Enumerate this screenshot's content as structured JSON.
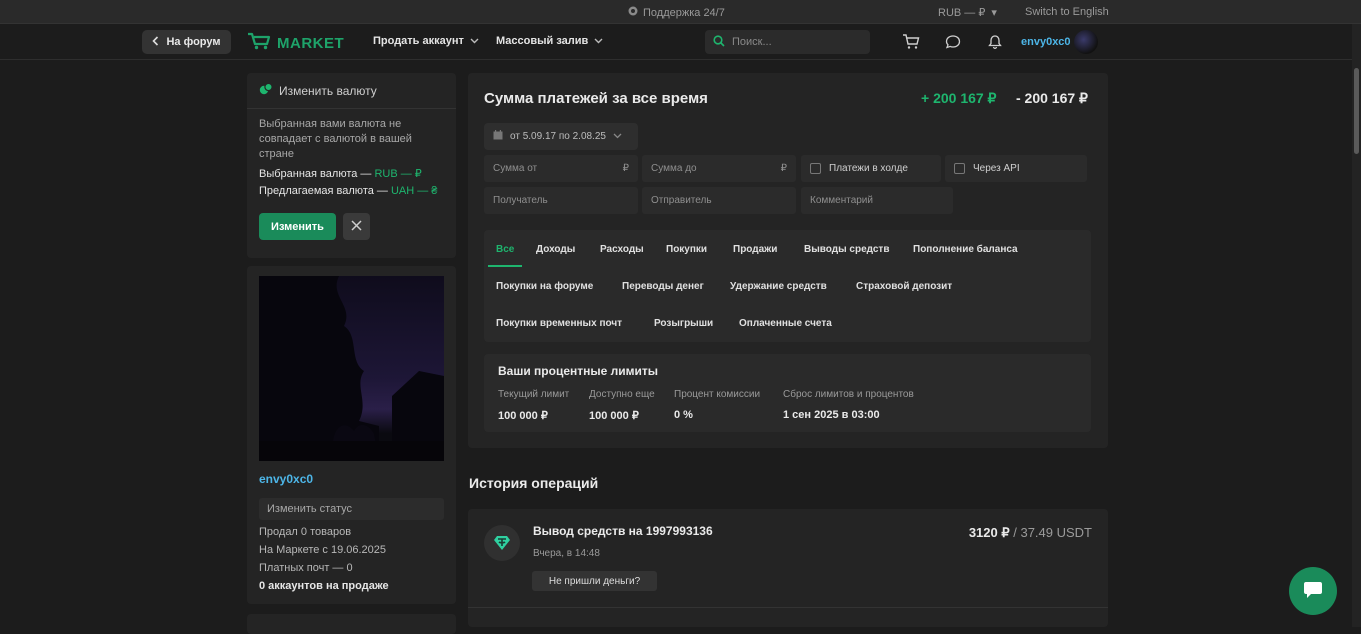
{
  "topbar": {
    "support": "Поддержка 24/7",
    "currency": "RUB — ₽",
    "currency_arrow": "▾",
    "language": "Switch to English"
  },
  "nav": {
    "back_label": "На форум",
    "logo_text": "MARKET",
    "menu": [
      {
        "label": "Продать аккаунт"
      },
      {
        "label": "Массовый залив"
      }
    ],
    "search_placeholder": "Поиск...",
    "username": "envy0xc0"
  },
  "currency_card": {
    "title": "Изменить валюту",
    "text": "Выбранная вами валюта не совпадает с валютой в вашей стране",
    "selected_label": "Выбранная валюта — ",
    "selected_value": "RUB — ₽",
    "suggested_label": "Предлагаемая валюта — ",
    "suggested_value": "UAH — ₴",
    "change_button": "Изменить"
  },
  "profile": {
    "name": "envy0xc0",
    "status_placeholder": "Изменить статус",
    "sold": "Продал 0 товаров",
    "since": "На Маркете с 19.06.2025",
    "paid_mail": "Платных почт — 0",
    "accounts": "0 аккаунтов на продаже"
  },
  "payments": {
    "title": "Сумма платежей за все время",
    "income": "+ 200 167 ₽",
    "outcome": "- 200 167 ₽",
    "date_range": "от 5.09.17 по 2.08.25",
    "filters": {
      "sum_from": "Сумма от",
      "sum_to": "Сумма до",
      "currency_sign": "₽",
      "on_hold": "Платежи в холде",
      "via_api": "Через API",
      "recipient": "Получатель",
      "sender": "Отправитель",
      "comment": "Комментарий"
    },
    "tabs": [
      {
        "label": "Все"
      },
      {
        "label": "Доходы"
      },
      {
        "label": "Расходы"
      },
      {
        "label": "Покупки"
      },
      {
        "label": "Продажи"
      },
      {
        "label": "Выводы средств"
      },
      {
        "label": "Пополнение баланса"
      },
      {
        "label": "Покупки на форуме"
      },
      {
        "label": "Переводы денег"
      },
      {
        "label": "Удержание средств"
      },
      {
        "label": "Страховой депозит"
      },
      {
        "label": "Покупки временных почт"
      },
      {
        "label": "Розыгрыши"
      },
      {
        "label": "Оплаченные счета"
      }
    ],
    "active_tab": "Все"
  },
  "limits": {
    "title": "Ваши процентные лимиты",
    "columns": [
      {
        "label": "Текущий лимит",
        "value": "100 000 ₽"
      },
      {
        "label": "Доступно еще",
        "value": "100 000 ₽"
      },
      {
        "label": "Процент комиссии",
        "value": "0 %"
      },
      {
        "label": "Сброс лимитов и процентов",
        "value": "1 сен 2025 в 03:00"
      }
    ]
  },
  "history": {
    "title": "История операций",
    "items": [
      {
        "title": "Вывод средств на 1997993136",
        "time": "Вчера, в 14:48",
        "button": "Не пришли деньги?",
        "amount": "3120 ₽",
        "amount_alt": " / 37.49 USDT"
      }
    ]
  },
  "colors": {
    "accent": "#1eb56e",
    "button": "#1a8b5a",
    "link": "#4db6e8",
    "bg": "#1c1c1c",
    "card": "#242424"
  }
}
